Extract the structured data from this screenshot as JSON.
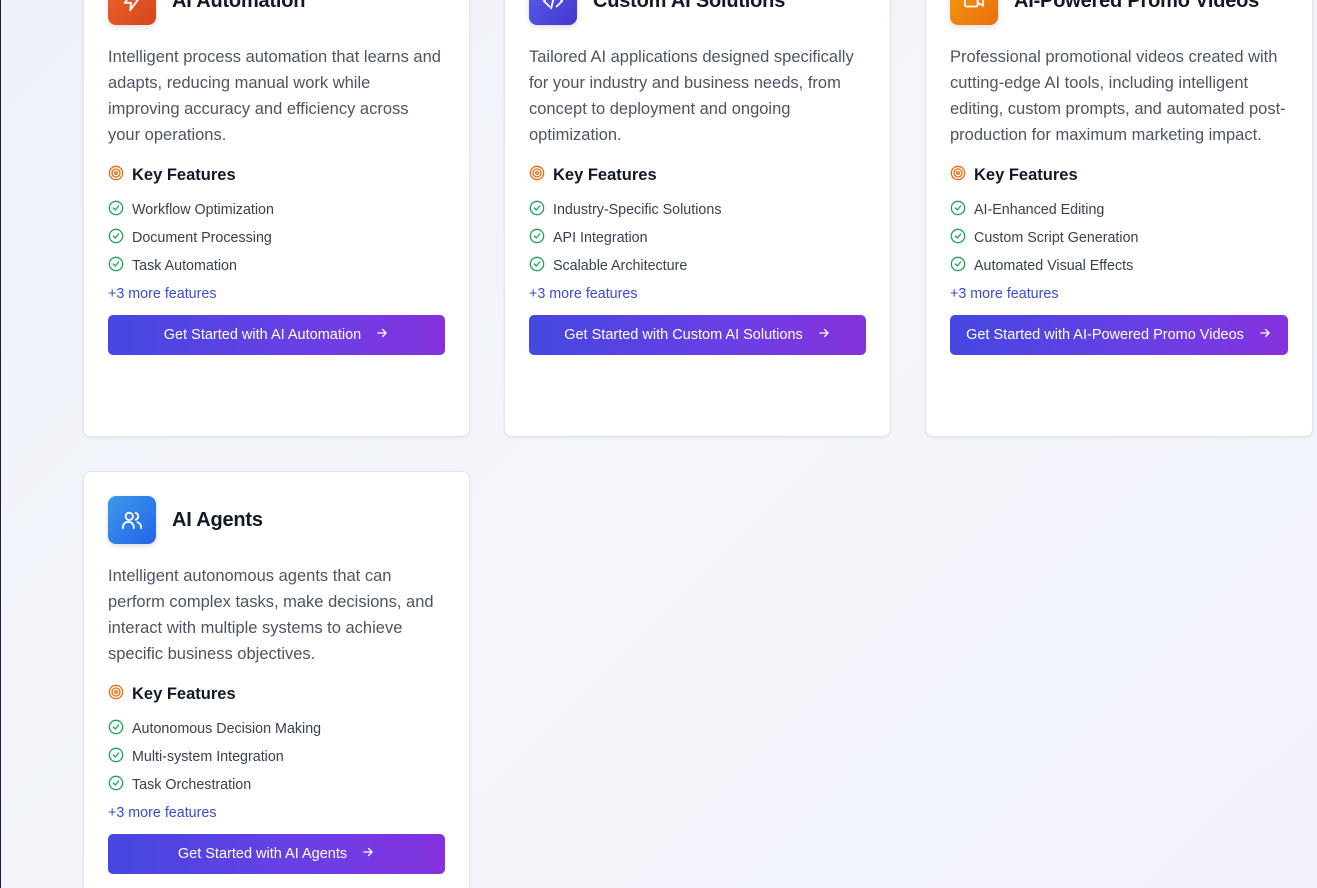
{
  "cards": [
    {
      "title": "AI Automation",
      "icon": "lightning-icon",
      "icon_colors": [
        "#f0642b",
        "#d4461c"
      ],
      "description": "Intelligent process automation that learns and adapts, reducing manual work while improving accuracy and efficiency across your operations.",
      "key_features_label": "Key Features",
      "features": [
        "Workflow Optimization",
        "Document Processing",
        "Task Automation"
      ],
      "more_features": "+3 more features",
      "cta": "Get Started with AI Automation"
    },
    {
      "title": "Custom AI Solutions",
      "icon": "code-icon",
      "icon_colors": [
        "#5b5ff0",
        "#4338ca"
      ],
      "description": "Tailored AI applications designed specifically for your industry and business needs, from concept to deployment and ongoing optimization.",
      "key_features_label": "Key Features",
      "features": [
        "Industry-Specific Solutions",
        "API Integration",
        "Scalable Architecture"
      ],
      "more_features": "+3 more features",
      "cta": "Get Started with Custom AI Solutions"
    },
    {
      "title": "AI-Powered Promo Videos",
      "icon": "video-camera-icon",
      "icon_colors": [
        "#f59e0b",
        "#ea6d12"
      ],
      "description": "Professional promotional videos created with cutting-edge AI tools, including intelligent editing, custom prompts, and automated post-production for maximum marketing impact.",
      "key_features_label": "Key Features",
      "features": [
        "AI-Enhanced Editing",
        "Custom Script Generation",
        "Automated Visual Effects"
      ],
      "more_features": "+3 more features",
      "cta": "Get Started with AI-Powered Promo Videos"
    },
    {
      "title": "AI Agents",
      "icon": "users-icon",
      "icon_colors": [
        "#3b9ae8",
        "#2563eb"
      ],
      "description": "Intelligent autonomous agents that can perform complex tasks, make decisions, and interact with multiple systems to achieve specific business objectives.",
      "key_features_label": "Key Features",
      "features": [
        "Autonomous Decision Making",
        "Multi-system Integration",
        "Task Orchestration"
      ],
      "more_features": "+3 more features",
      "cta": "Get Started with AI Agents"
    }
  ],
  "colors": {
    "check": "#22a35a",
    "target": "#ea6d12",
    "link": "#3b4bd6",
    "button_start": "#4447e0",
    "button_end": "#8531dd"
  }
}
